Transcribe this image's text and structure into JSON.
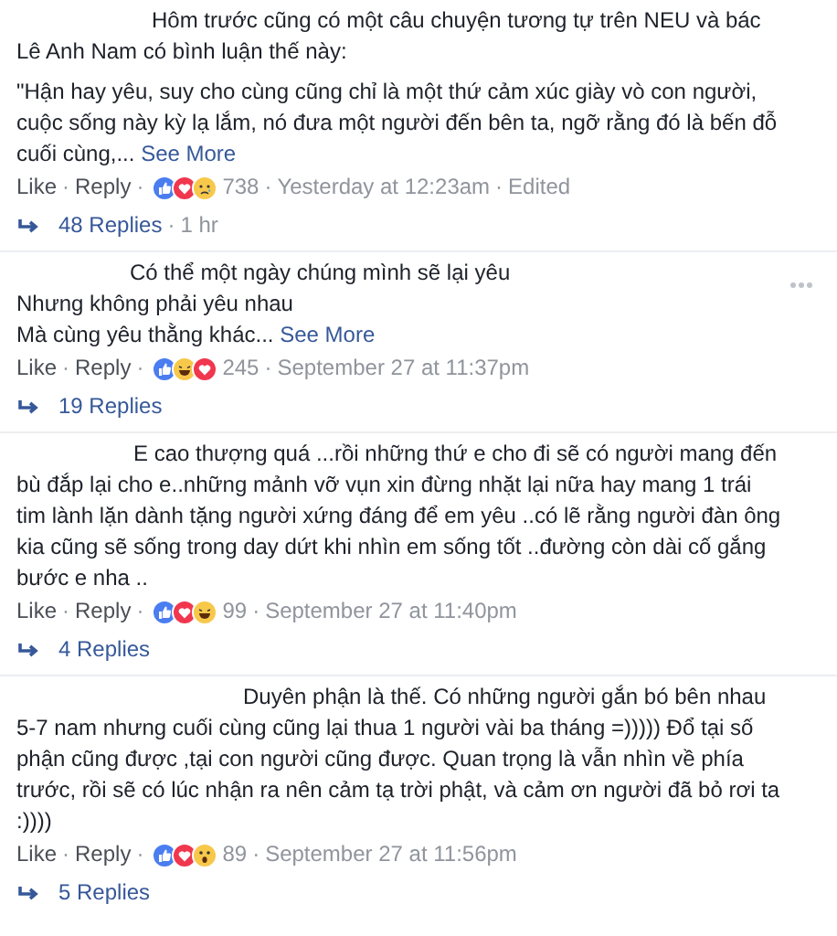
{
  "comments": [
    {
      "lines": [
        [
          "Hôm trước cũng có một câu chuyện tương tự trên NEU và bác Lê Anh Nam có bình luận thế này:"
        ],
        [
          "\"Hận hay yêu, suy cho cùng cũng chỉ là một thứ cảm xúc giày vò con người, cuộc sống này kỳ lạ lắm, nó đưa một người đến bên ta, ngỡ rằng đó là bến đỗ cuối cùng,..."
        ]
      ],
      "see_more": "See More",
      "menu_shown": false,
      "actions": [
        "Like",
        "Reply"
      ],
      "sep": "·",
      "reactions": [
        {
          "kind": "like"
        },
        {
          "kind": "love"
        },
        {
          "kind": "sad"
        }
      ],
      "reaction_count": "738",
      "time": "Yesterday at 12:23am",
      "edited": "Edited",
      "replies": "48 Replies",
      "replies_time": "1 hr"
    },
    {
      "lines": [
        [
          "Có thể một ngày chúng mình sẽ lại yêu",
          "Nhưng không phải yêu nhau",
          "Mà cùng yêu thằng khác..."
        ]
      ],
      "see_more": "See More",
      "menu_shown": true,
      "actions": [
        "Like",
        "Reply"
      ],
      "sep": "·",
      "reactions": [
        {
          "kind": "like"
        },
        {
          "kind": "haha"
        },
        {
          "kind": "love"
        }
      ],
      "reaction_count": "245",
      "time": "September 27 at 11:37pm",
      "replies": "19 Replies"
    },
    {
      "lines": [
        [
          "E cao thượng quá ...rồi những thứ e cho đi sẽ có người mang đến bù đắp lại cho e..những mảnh vỡ vụn xin đừng nhặt lại nữa hay mang 1 trái tim lành lặn dành tặng người xứng đáng để em yêu ..có lẽ rằng người đàn ông kia cũng sẽ sống trong day dứt khi nhìn em sống tốt ..đường còn dài cố gắng bước e nha .."
        ]
      ],
      "menu_shown": false,
      "actions": [
        "Like",
        "Reply"
      ],
      "sep": "·",
      "reactions": [
        {
          "kind": "like"
        },
        {
          "kind": "love"
        },
        {
          "kind": "haha"
        }
      ],
      "reaction_count": "99",
      "time": "September 27 at 11:40pm",
      "replies": "4 Replies"
    },
    {
      "lines": [
        [
          "Duyên phận là thế. Có những người gắn bó bên nhau 5-7 nam nhưng cuối cùng cũng lại thua 1 người vài ba tháng =))))) Đổ tại số phận cũng được ,tại con người cũng được. Quan trọng là vẫn nhìn về phía trước, rồi sẽ có lúc nhận ra nên cảm tạ trời phật, và cảm ơn người đã bỏ rơi ta :))))"
        ]
      ],
      "menu_shown": false,
      "actions": [
        "Like",
        "Reply"
      ],
      "sep": "·",
      "reactions": [
        {
          "kind": "like"
        },
        {
          "kind": "love"
        },
        {
          "kind": "wow"
        }
      ],
      "reaction_count": "89",
      "time": "September 27 at 11:56pm",
      "replies": "5 Replies"
    }
  ]
}
